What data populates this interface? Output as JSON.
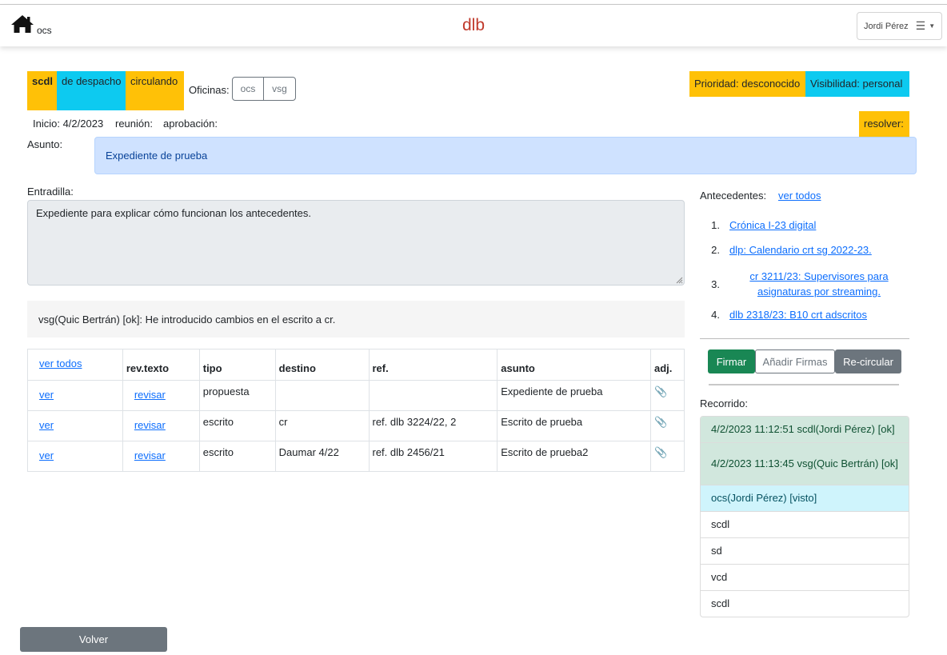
{
  "nav": {
    "home_label": "ocs",
    "title": "dlb",
    "user": "Jordi Pérez",
    "title_color": "#c0392b"
  },
  "status": {
    "tags": [
      "scdl",
      "de despacho",
      "circulando"
    ],
    "oficinas_label": "Oficinas:",
    "oficinas": [
      "ocs",
      "vsg"
    ],
    "prioridad": "Prioridad: desconocido",
    "visibilidad": "Visibilidad: personal",
    "resolver": "resolver:"
  },
  "dates": {
    "inicio": "Inicio: 4/2/2023",
    "reunion": "reunión:",
    "aprobacion": "aprobación:"
  },
  "asunto": {
    "label": "Asunto:",
    "value": "Expediente de prueba"
  },
  "entradilla": {
    "label": "Entradilla:",
    "value": "Expediente para explicar cómo funcionan los antecedentes."
  },
  "comment": "vsg(Quic Bertrán) [ok]: He introducido cambios en el escrito a cr.",
  "table": {
    "ver_todos": "ver todos",
    "headers": [
      "rev.texto",
      "tipo",
      "destino",
      "ref.",
      "asunto",
      "adj."
    ],
    "rows": [
      {
        "ver": "ver",
        "revisar": "revisar",
        "tipo": "propuesta",
        "destino": "",
        "ref": "",
        "asunto": "Expediente de prueba"
      },
      {
        "ver": "ver",
        "revisar": "revisar",
        "tipo": "escrito",
        "destino": "cr",
        "ref": "ref. dlb 3224/22, 2",
        "asunto": "Escrito de prueba"
      },
      {
        "ver": "ver",
        "revisar": "revisar",
        "tipo": "escrito",
        "destino": "Daumar 4/22",
        "ref": "ref. dlb 2456/21",
        "asunto": "Escrito de prueba2"
      }
    ]
  },
  "antecedentes": {
    "label": "Antecedentes:",
    "ver_todos": "ver todos",
    "items": [
      {
        "num": "1.",
        "text": "Crónica I-23 digital"
      },
      {
        "num": "2.",
        "text": "dlp: Calendario crt sg 2022-23."
      },
      {
        "num": "3.",
        "text": "cr 3211/23: Supervisores para asignaturas por streaming."
      },
      {
        "num": "4.",
        "text": "dlb 2318/23: B10 crt adscritos"
      }
    ]
  },
  "actions": {
    "firmar": "Firmar",
    "anadir_firmas": "Añadir Firmas",
    "recircular": "Re-circular"
  },
  "recorrido": {
    "label": "Recorrido:",
    "items": [
      "4/2/2023 11:12:51 scdl(Jordi Pérez) [ok]",
      "4/2/2023 11:13:45 vsg(Quic Bertrán) [ok]",
      "ocs(Jordi Pérez) [visto]",
      "scdl",
      "sd",
      "vcd",
      "scdl"
    ]
  },
  "volver": "Volver",
  "colors": {
    "yellow": "#ffc107",
    "cyan": "#0dcaf0",
    "success": "#198754",
    "secondary": "#6c757d",
    "link": "#0d6efd"
  }
}
